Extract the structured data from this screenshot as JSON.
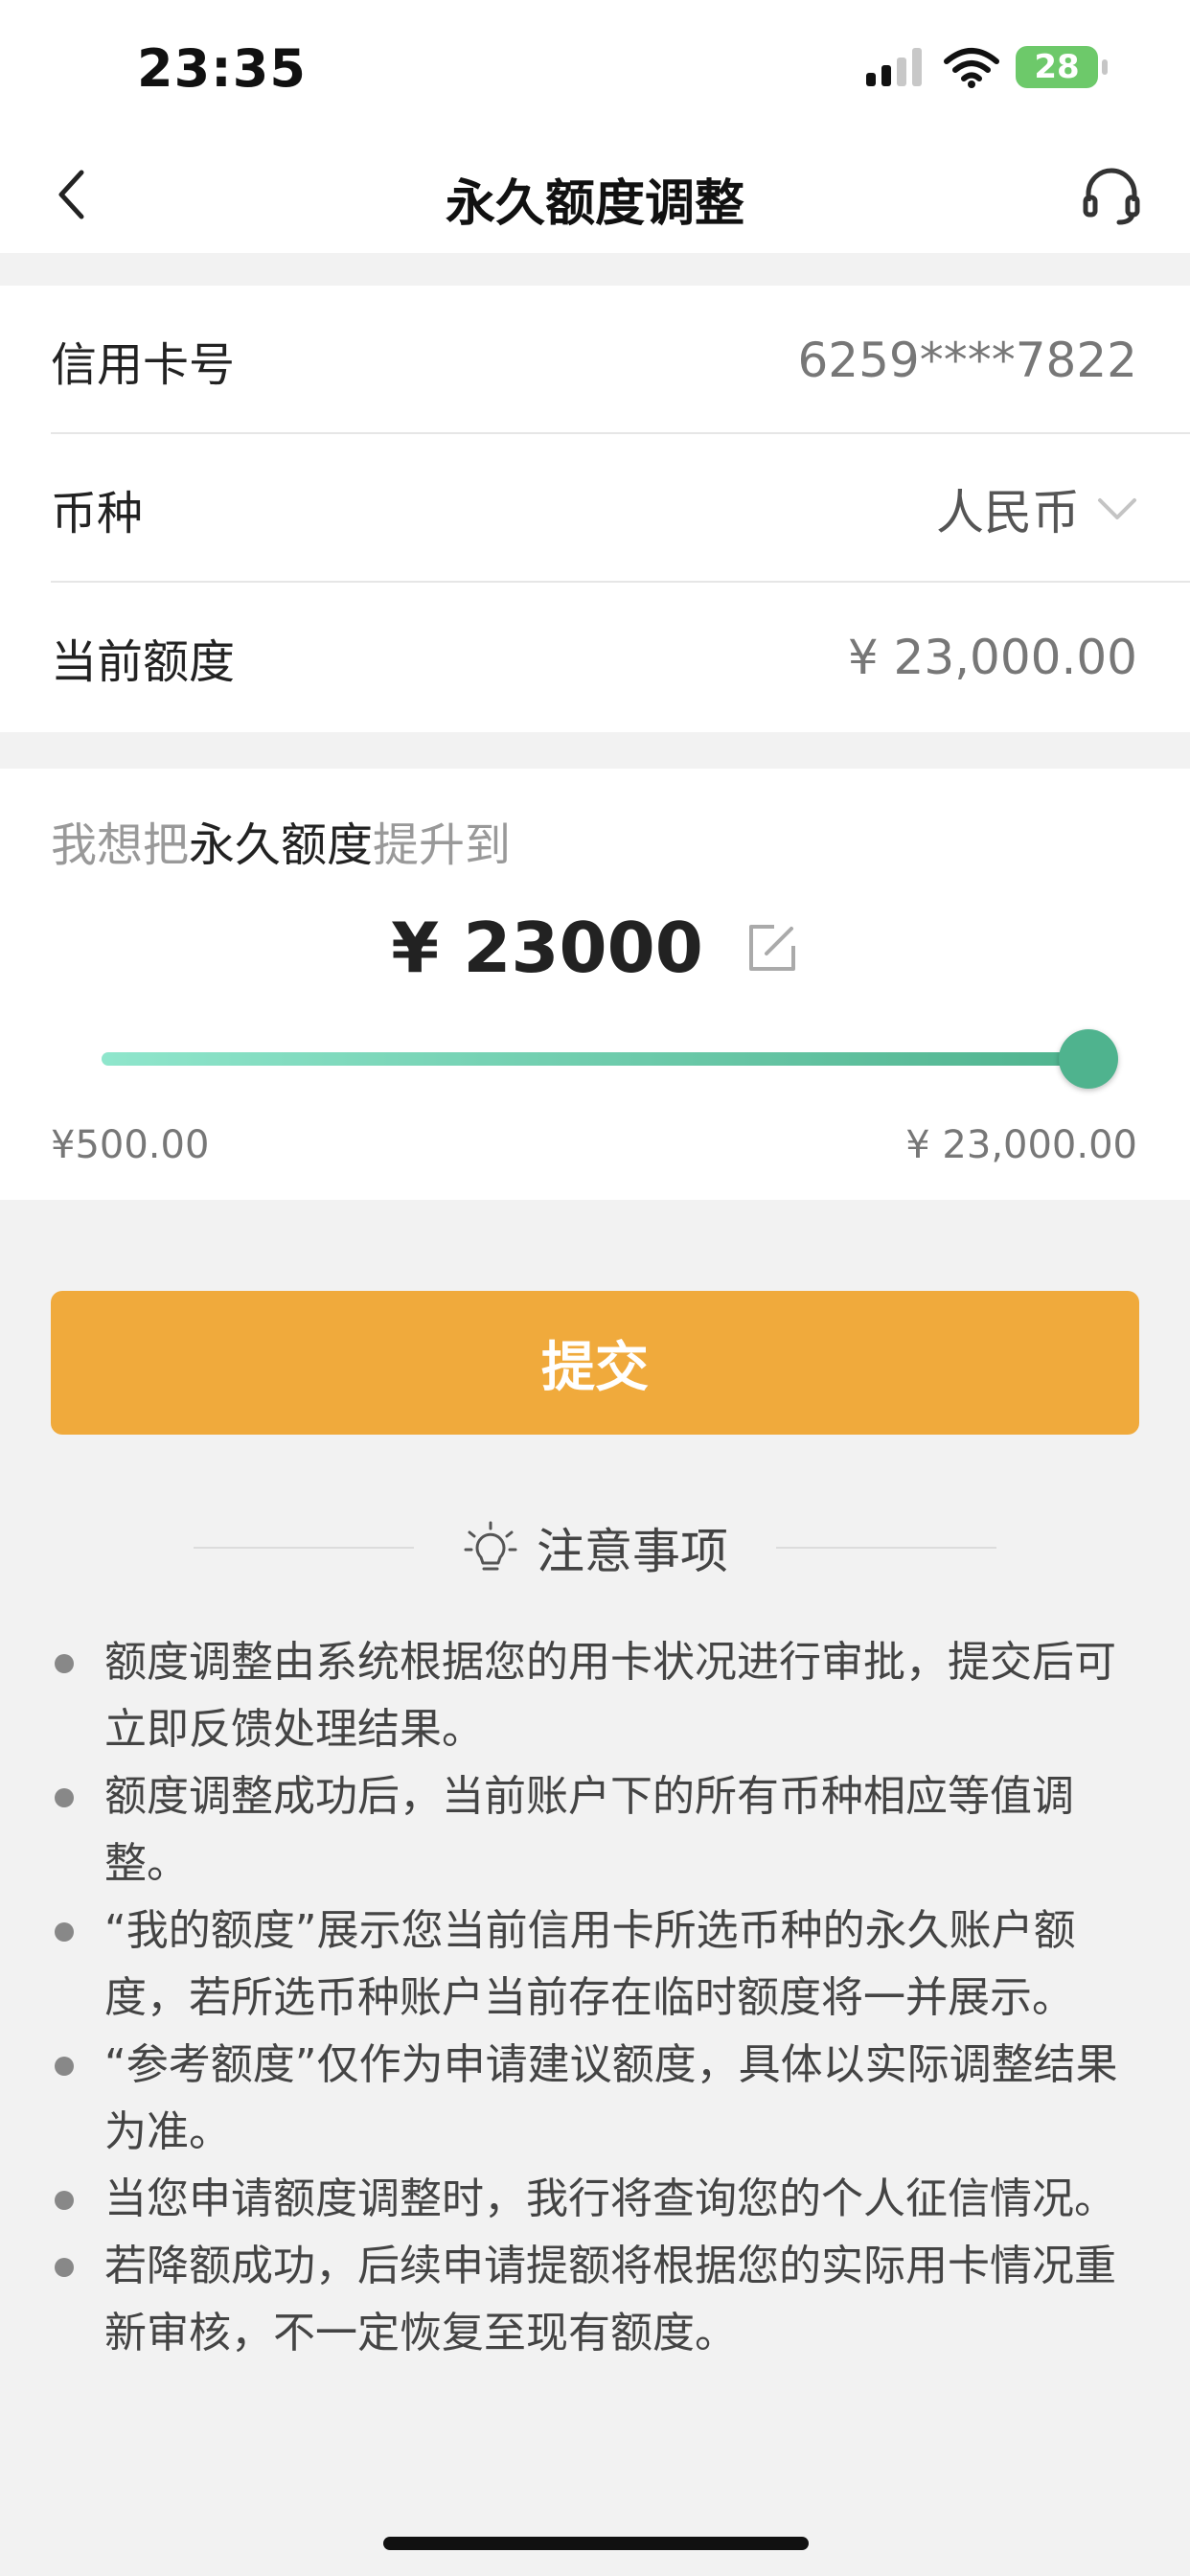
{
  "status": {
    "time": "23:35",
    "battery": "28"
  },
  "nav": {
    "title": "永久额度调整"
  },
  "card": {
    "card_number_label": "信用卡号",
    "card_number": "6259****7822",
    "currency_label": "币种",
    "currency": "人民币",
    "current_limit_label": "当前额度",
    "current_limit": "¥ 23,000.00"
  },
  "adjust": {
    "prompt_pre": "我想把",
    "prompt_highlight": "永久额度",
    "prompt_post": "提升到",
    "amount": "¥ 23000",
    "min": "¥500.00",
    "max": "¥ 23,000.00",
    "slider_fraction": 1.0
  },
  "submit_label": "提交",
  "notice": {
    "title": "注意事项",
    "items": [
      "额度调整由系统根据您的用卡状况进行审批，提交后可立即反馈处理结果。",
      "额度调整成功后，当前账户下的所有币种相应等值调整。",
      "“我的额度”展示您当前信用卡所选币种的永久账户额度，若所选币种账户当前存在临时额度将一并展示。",
      "“参考额度”仅作为申请建议额度，具体以实际调整结果为准。",
      "当您申请额度调整时，我行将查询您的个人征信情况。",
      "若降额成功，后续申请提额将根据您的实际用卡情况重新审核，不一定恢复至现有额度。"
    ]
  },
  "colors": {
    "accent_orange": "#f0aa3c",
    "slider_green": "#4fb38e",
    "slider_light": "#8fe6cc"
  },
  "icons": {
    "back": "chevron-left-icon",
    "service": "headset-icon",
    "edit": "edit-icon",
    "notice": "lightbulb-icon",
    "currency": "chevron-down-icon"
  }
}
